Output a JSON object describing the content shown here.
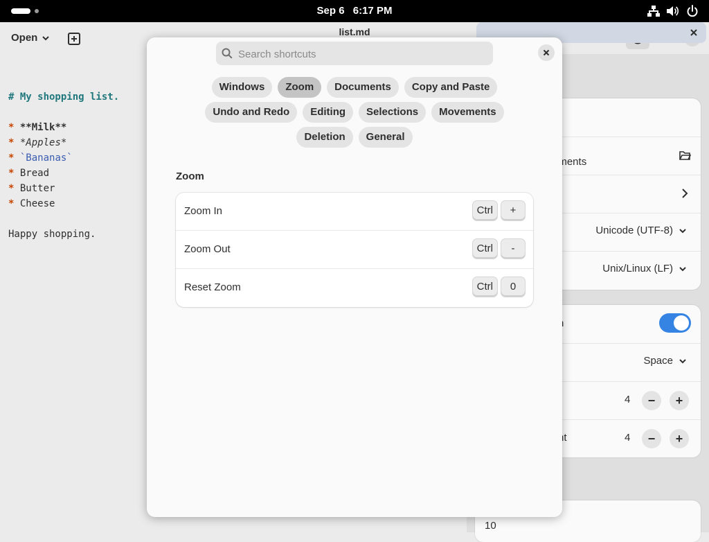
{
  "system_bar": {
    "date": "Sep 6",
    "time": "6:17 PM",
    "icons": [
      "network-icon",
      "volume-icon",
      "power-icon"
    ]
  },
  "editor": {
    "open_label": "Open",
    "title": "list.md",
    "document_lines": [
      "# My shopping list.",
      "",
      "* **Milk**",
      "* *Apples*",
      "* `Bananas`",
      "* Bread",
      "* Butter",
      "* Cheese",
      "",
      "Happy shopping."
    ],
    "heading_line": "# My shopping list.",
    "bullet": "*",
    "items": [
      "**Milk**",
      "*Apples*",
      "`Bananas`",
      "Bread",
      "Butter",
      "Cheese"
    ],
    "footer_line": "Happy shopping."
  },
  "sidebar": {
    "documents_fragment": "uments",
    "encoding": "Unicode (UTF-8)",
    "line_ending": "Unix/Linux (LF)",
    "toggle_fragment": "n",
    "indent_type": "Space",
    "tab_width": "4",
    "indent_fragment": "nt",
    "indent_width": "4",
    "bottom_value": "10",
    "toggle_on": true
  },
  "dialog": {
    "search_placeholder": "Search shortcuts",
    "categories": [
      [
        "Windows",
        "Zoom",
        "Documents",
        "Copy and Paste"
      ],
      [
        "Undo and Redo",
        "Editing",
        "Selections",
        "Movements"
      ],
      [
        "Deletion",
        "General"
      ]
    ],
    "active_category": "Zoom",
    "section_title": "Zoom",
    "shortcuts": [
      {
        "label": "Zoom In",
        "keys": [
          "Ctrl",
          "+"
        ]
      },
      {
        "label": "Zoom Out",
        "keys": [
          "Ctrl",
          "-"
        ]
      },
      {
        "label": "Reset Zoom",
        "keys": [
          "Ctrl",
          "0"
        ]
      }
    ]
  },
  "colors": {
    "accent": "#3584e4",
    "markdown_heading": "#20787d",
    "markdown_bullet": "#c64600",
    "markdown_code": "#3a5cb0"
  }
}
